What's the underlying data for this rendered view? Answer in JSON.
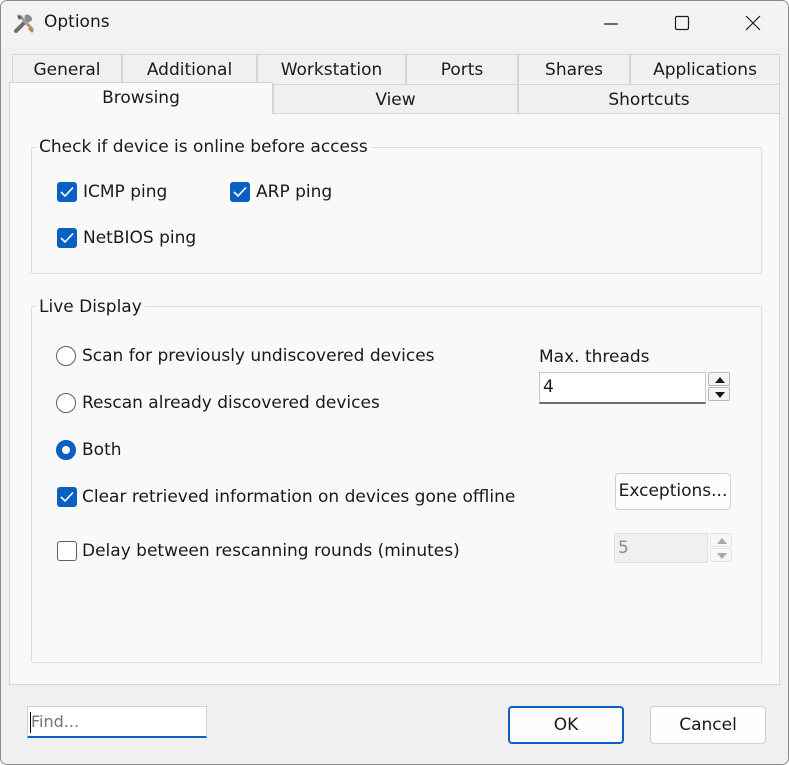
{
  "window": {
    "title": "Options"
  },
  "tabs": {
    "row1": [
      "General",
      "Additional",
      "Workstation",
      "Ports",
      "Shares",
      "Applications"
    ],
    "row2": [
      "Browsing",
      "View",
      "Shortcuts"
    ],
    "active": "Browsing"
  },
  "online_check": {
    "title": "Check if device is online before access",
    "icmp": {
      "label": "ICMP ping",
      "checked": true
    },
    "arp": {
      "label": "ARP ping",
      "checked": true
    },
    "netbios": {
      "label": "NetBIOS ping",
      "checked": true
    }
  },
  "live_display": {
    "title": "Live Display",
    "scan_new_label": "Scan for previously undiscovered devices",
    "rescan_label": "Rescan already discovered devices",
    "both_label": "Both",
    "selected": "Both",
    "clear_info": {
      "label": "Clear retrieved information on devices gone offline",
      "checked": true
    },
    "delay": {
      "label": "Delay between rescanning rounds (minutes)",
      "checked": false,
      "value": "5"
    },
    "max_threads": {
      "label": "Max. threads",
      "value": "4"
    },
    "exceptions_label": "Exceptions..."
  },
  "footer": {
    "find_placeholder": "Find...",
    "ok_label": "OK",
    "cancel_label": "Cancel"
  },
  "colors": {
    "accent": "#0a5fc2"
  }
}
